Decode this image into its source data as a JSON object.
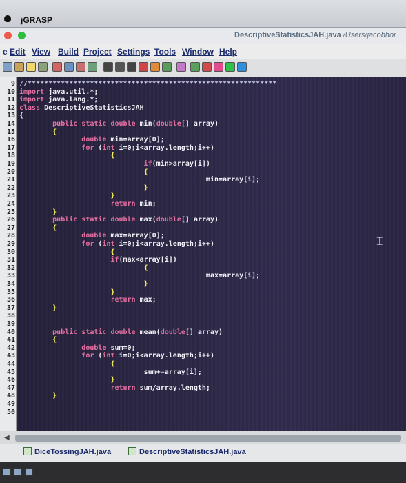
{
  "app": {
    "name": "jGRASP"
  },
  "window": {
    "title_file": "DescriptiveStatisticsJAH.java",
    "title_path": "/Users/jacobhor"
  },
  "menu": [
    "Edit",
    "View",
    "Build",
    "Project",
    "Settings",
    "Tools",
    "Window",
    "Help"
  ],
  "menu_partial_prefix": "e",
  "toolbar": {
    "icons": [
      "new-file-icon",
      "open-file-icon",
      "save-icon",
      "cut-icon",
      "copy-icon",
      "paste-icon",
      "undo-icon",
      "find-icon",
      "compile-icon",
      "run-icon",
      "debug-icon",
      "step-icon",
      "stop-icon",
      "uml-icon",
      "viewer-icon",
      "color-icon",
      "split-icon"
    ]
  },
  "editor": {
    "lines": [
      {
        "num": "9",
        "segments": [
          {
            "t": "//************************************************************",
            "k": "comment"
          }
        ]
      },
      {
        "num": "10",
        "segments": [
          {
            "t": "import",
            "k": "keyword"
          },
          {
            "t": " java.util.*;",
            "k": "white"
          }
        ]
      },
      {
        "num": "11",
        "segments": [
          {
            "t": "import",
            "k": "keyword"
          },
          {
            "t": " java.lang.*;",
            "k": "white"
          }
        ]
      },
      {
        "num": "12",
        "segments": [
          {
            "t": "class",
            "k": "keyword"
          },
          {
            "t": " DescriptiveStatisticsJAH",
            "k": "white"
          }
        ]
      },
      {
        "num": "13",
        "segments": [
          {
            "t": "{",
            "k": "white"
          }
        ]
      },
      {
        "num": "14",
        "segments": [
          {
            "t": "        public static double",
            "k": "keyword"
          },
          {
            "t": " min(",
            "k": "white"
          },
          {
            "t": "double",
            "k": "keyword"
          },
          {
            "t": "[] array)",
            "k": "white"
          }
        ]
      },
      {
        "num": "15",
        "segments": [
          {
            "t": "        {",
            "k": "brace"
          }
        ]
      },
      {
        "num": "16",
        "segments": [
          {
            "t": "               double",
            "k": "keyword"
          },
          {
            "t": " min=array[0];",
            "k": "white"
          }
        ]
      },
      {
        "num": "17",
        "segments": [
          {
            "t": "               for",
            "k": "keyword"
          },
          {
            "t": " (",
            "k": "white"
          },
          {
            "t": "int",
            "k": "keyword"
          },
          {
            "t": " i=0;i<array.length;i++)",
            "k": "white"
          }
        ]
      },
      {
        "num": "18",
        "segments": [
          {
            "t": "                      {",
            "k": "brace"
          }
        ]
      },
      {
        "num": "19",
        "segments": [
          {
            "t": "                              if",
            "k": "keyword"
          },
          {
            "t": "(min>array[i])",
            "k": "white"
          }
        ]
      },
      {
        "num": "20",
        "segments": [
          {
            "t": "                              {",
            "k": "brace"
          }
        ]
      },
      {
        "num": "21",
        "segments": [
          {
            "t": "                                             min=array[i];",
            "k": "white"
          }
        ]
      },
      {
        "num": "22",
        "segments": [
          {
            "t": "                              }",
            "k": "brace"
          }
        ]
      },
      {
        "num": "23",
        "segments": [
          {
            "t": "                      }",
            "k": "brace"
          }
        ]
      },
      {
        "num": "24",
        "segments": [
          {
            "t": "                      return",
            "k": "keyword"
          },
          {
            "t": " min;",
            "k": "white"
          }
        ]
      },
      {
        "num": "25",
        "segments": [
          {
            "t": "        }",
            "k": "brace"
          }
        ]
      },
      {
        "num": "26",
        "segments": [
          {
            "t": "        public static double",
            "k": "keyword"
          },
          {
            "t": " max(",
            "k": "white"
          },
          {
            "t": "double",
            "k": "keyword"
          },
          {
            "t": "[] array)",
            "k": "white"
          }
        ]
      },
      {
        "num": "27",
        "segments": [
          {
            "t": "        {",
            "k": "brace"
          }
        ]
      },
      {
        "num": "28",
        "segments": [
          {
            "t": "               double",
            "k": "keyword"
          },
          {
            "t": " max=array[0];",
            "k": "white"
          }
        ]
      },
      {
        "num": "29",
        "segments": [
          {
            "t": "               for",
            "k": "keyword"
          },
          {
            "t": " (",
            "k": "white"
          },
          {
            "t": "int",
            "k": "keyword"
          },
          {
            "t": " i=0;i<array.length;i++)",
            "k": "white"
          }
        ]
      },
      {
        "num": "30",
        "segments": [
          {
            "t": "                      {",
            "k": "brace"
          }
        ]
      },
      {
        "num": "31",
        "segments": [
          {
            "t": "                      if",
            "k": "keyword"
          },
          {
            "t": "(max<array[i])",
            "k": "white"
          }
        ]
      },
      {
        "num": "32",
        "segments": [
          {
            "t": "                              {",
            "k": "brace"
          }
        ]
      },
      {
        "num": "33",
        "segments": [
          {
            "t": "                                             max=array[i];",
            "k": "white"
          }
        ]
      },
      {
        "num": "34",
        "segments": [
          {
            "t": "                              }",
            "k": "brace"
          }
        ]
      },
      {
        "num": "35",
        "segments": [
          {
            "t": "                      }",
            "k": "brace"
          }
        ]
      },
      {
        "num": "36",
        "segments": [
          {
            "t": "                      return",
            "k": "keyword"
          },
          {
            "t": " max;",
            "k": "white"
          }
        ]
      },
      {
        "num": "37",
        "segments": [
          {
            "t": "        }",
            "k": "brace"
          }
        ]
      },
      {
        "num": "38",
        "segments": []
      },
      {
        "num": "39",
        "segments": []
      },
      {
        "num": "40",
        "segments": [
          {
            "t": "        public static double",
            "k": "keyword"
          },
          {
            "t": " mean(",
            "k": "white"
          },
          {
            "t": "double",
            "k": "keyword"
          },
          {
            "t": "[] array)",
            "k": "white"
          }
        ]
      },
      {
        "num": "41",
        "segments": [
          {
            "t": "        {",
            "k": "brace"
          }
        ]
      },
      {
        "num": "42",
        "segments": [
          {
            "t": "               double",
            "k": "keyword"
          },
          {
            "t": " sum=0;",
            "k": "white"
          }
        ]
      },
      {
        "num": "43",
        "segments": [
          {
            "t": "               for",
            "k": "keyword"
          },
          {
            "t": " (",
            "k": "white"
          },
          {
            "t": "int",
            "k": "keyword"
          },
          {
            "t": " i=0;i<array.length;i++)",
            "k": "white"
          }
        ]
      },
      {
        "num": "44",
        "segments": [
          {
            "t": "                      {",
            "k": "brace"
          }
        ]
      },
      {
        "num": "45",
        "segments": [
          {
            "t": "                              sum+=array[i];",
            "k": "white"
          }
        ]
      },
      {
        "num": "46",
        "segments": [
          {
            "t": "                      }",
            "k": "brace"
          }
        ]
      },
      {
        "num": "47",
        "segments": [
          {
            "t": "                      return",
            "k": "keyword"
          },
          {
            "t": " sum/array.length;",
            "k": "white"
          }
        ]
      },
      {
        "num": "48",
        "segments": [
          {
            "t": "        }",
            "k": "brace"
          }
        ]
      },
      {
        "num": "49",
        "segments": []
      },
      {
        "num": "50",
        "segments": []
      }
    ]
  },
  "file_tabs": [
    {
      "label": "DiceTossingJAH.java",
      "active": false
    },
    {
      "label": "DescriptiveStatisticsJAH.java",
      "active": true
    }
  ],
  "colors": {
    "comment": "#c7c9e8",
    "keyword": "#e46fa2",
    "white": "#f0eef6",
    "brace": "#f4ee5a"
  }
}
